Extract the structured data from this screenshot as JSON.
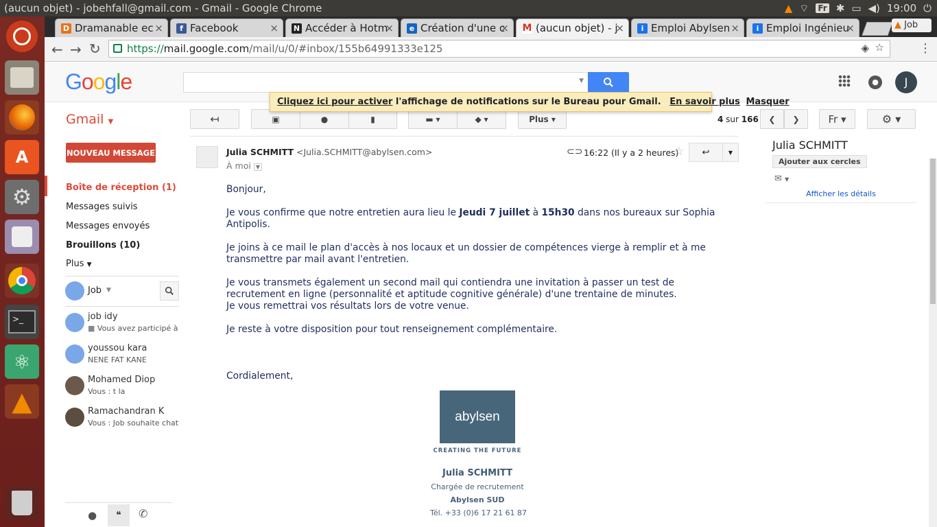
{
  "window": {
    "title": "(aucun objet) - jobehfall@gmail.com - Gmail - Google Chrome"
  },
  "tray": {
    "keyboard": "Fr",
    "time": "19:00"
  },
  "tabs": [
    {
      "label": "Dramanable ec",
      "fav_color": "#e8731a",
      "fav": "D"
    },
    {
      "label": "Facebook",
      "fav_color": "#3b5998",
      "fav": "f"
    },
    {
      "label": "Accéder à Hotm",
      "fav_color": "#222222",
      "fav": "N"
    },
    {
      "label": "Création d'une c",
      "fav_color": "#1565c0",
      "fav": "e"
    },
    {
      "label": "(aucun objet) - j",
      "fav_color": "#ffffff",
      "fav": "M"
    },
    {
      "label": "Emploi Abylsen",
      "fav_color": "#1a73e8",
      "fav": "i"
    },
    {
      "label": "Emploi Ingénieu",
      "fav_color": "#1a73e8",
      "fav": "i"
    }
  ],
  "profile_tab": "Job",
  "omnibox": {
    "scheme": "https://",
    "host": "mail.google.com",
    "path": "/mail/u/0/#inbox/155b64991333e125"
  },
  "google": {
    "logo": "Google",
    "avatar": "J"
  },
  "notification": {
    "link": "Cliquez ici pour activer",
    "text": " l'affichage de notifications sur le Bureau pour Gmail.",
    "learn": "En savoir plus",
    "hide": "Masquer"
  },
  "actions": {
    "gmail_label": "Gmail",
    "more_label": "Plus",
    "count_prefix": "4",
    "count_mid": " sur ",
    "count_total": "166",
    "lang": "Fr"
  },
  "nav": {
    "compose": "NOUVEAU MESSAGE",
    "inbox": "Boîte de réception (1)",
    "starred": "Messages suivis",
    "sent": "Messages envoyés",
    "drafts": "Brouillons (10)",
    "more": "Plus"
  },
  "chat": {
    "me": "Job",
    "contacts": [
      {
        "name": "job idy",
        "status": "Vous avez participé à un",
        "avatar": "#7aa7e8"
      },
      {
        "name": "youssou kara",
        "status": "NENE FAT KANE",
        "avatar": "#7aa7e8"
      },
      {
        "name": "Mohamed Diop",
        "status": "Vous : t la",
        "avatar": "#6b5a4c"
      },
      {
        "name": "Ramachandran K",
        "status": "Vous : Job souhaite chatter",
        "avatar": "#5b4d40"
      }
    ]
  },
  "message": {
    "sender_name": "Julia SCHMITT",
    "sender_email": "<Julia.SCHMITT@abylsen.com>",
    "to": "À moi",
    "time": "16:22 (Il y a 2 heures)",
    "greeting": "Bonjour,",
    "p1a": "Je vous confirme que notre entretien aura lieu le ",
    "p1b": "Jeudi 7 juillet",
    "p1c": " à ",
    "p1d": "15h30",
    "p1e": " dans nos bureaux sur Sophia Antipolis.",
    "p2": "Je joins à ce mail le plan d'accès à nos locaux et un dossier de compétences vierge à remplir et à me transmettre par mail avant l'entretien.",
    "p3a": "Je vous transmets également un second mail qui contiendra une invitation à passer un test de recrutement en ligne (personnalité et aptitude cognitive générale) d'une trentaine de minutes.",
    "p3b": "Je vous remettrai vos résultats lors de votre venue.",
    "p4": "Je reste à votre disposition pour tout renseignement complémentaire.",
    "closing": "Cordialement,"
  },
  "signature": {
    "logo": "abylsen",
    "tagline": "CREATING THE FUTURE",
    "name": "Julia SCHMITT",
    "role": "Chargée de recrutement",
    "company": "Abylsen SUD",
    "phone": "Tél. +33 (0)6 17 21 61 87",
    "logo_color": "#476679"
  },
  "contact_card": {
    "name": "Julia SCHMITT",
    "add": "Ajouter aux cercles",
    "details": "Afficher les détails"
  }
}
